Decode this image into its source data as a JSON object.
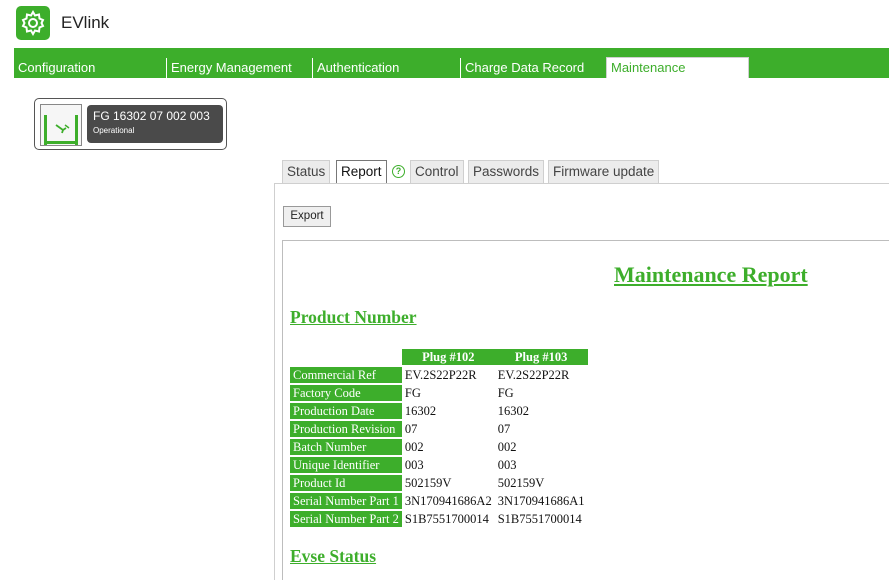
{
  "header": {
    "brand": "EVlink",
    "logo_icon": "gear-icon",
    "accent": "#3dae2b"
  },
  "topnav": {
    "tabs": [
      {
        "label": "Configuration",
        "active": false
      },
      {
        "label": "Energy Management",
        "active": false
      },
      {
        "label": "Authentication",
        "active": false
      },
      {
        "label": "Charge Data Record",
        "active": false
      },
      {
        "label": "Maintenance",
        "active": true
      }
    ]
  },
  "device": {
    "name": "FG 16302 07 002 003",
    "status": "Operational",
    "icon": "charging-station-icon"
  },
  "subtabs": {
    "tabs": [
      {
        "label": "Status",
        "active": false
      },
      {
        "label": "Report",
        "active": true
      },
      {
        "label": "Control",
        "active": false
      },
      {
        "label": "Passwords",
        "active": false
      },
      {
        "label": "Firmware update",
        "active": false
      }
    ],
    "help_icon": "help-circle-icon",
    "help_glyph": "?"
  },
  "toolbar": {
    "export_label": "Export"
  },
  "report": {
    "title": "Maintenance Report",
    "product_section": "Product Number",
    "evse_section": "Evse Status",
    "columns": [
      "Plug #102",
      "Plug #103"
    ],
    "rows": [
      {
        "label": "Commercial Ref",
        "values": [
          "EV.2S22P22R",
          "EV.2S22P22R"
        ]
      },
      {
        "label": "Factory Code",
        "values": [
          "FG",
          "FG"
        ]
      },
      {
        "label": "Production Date",
        "values": [
          "16302",
          "16302"
        ]
      },
      {
        "label": "Production Revision",
        "values": [
          "07",
          "07"
        ]
      },
      {
        "label": "Batch Number",
        "values": [
          "002",
          "002"
        ]
      },
      {
        "label": "Unique Identifier",
        "values": [
          "003",
          "003"
        ]
      },
      {
        "label": "Product Id",
        "values": [
          "502159V",
          "502159V"
        ]
      },
      {
        "label": "Serial Number Part 1",
        "values": [
          "3N170941686A2",
          "3N170941686A1"
        ]
      },
      {
        "label": "Serial Number Part 2",
        "values": [
          "S1B7551700014",
          "S1B7551700014"
        ]
      }
    ]
  }
}
